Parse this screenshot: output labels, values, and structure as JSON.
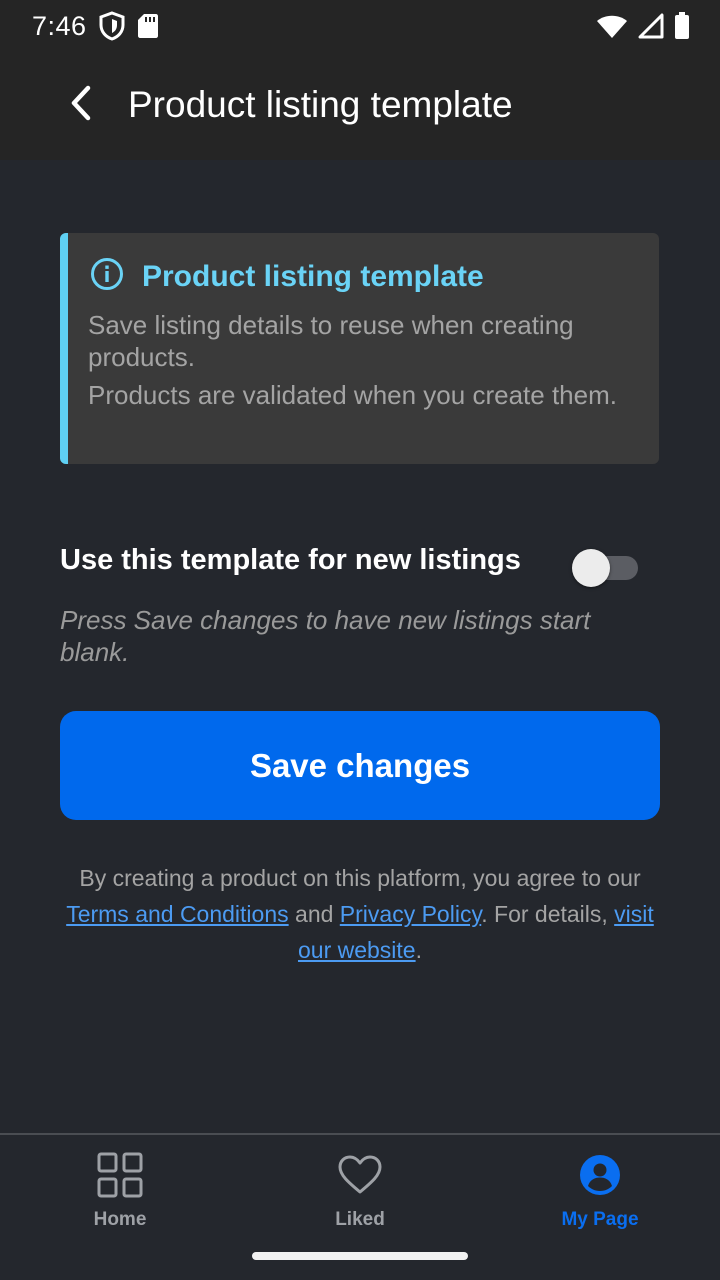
{
  "status_bar": {
    "time": "7:46",
    "icons": [
      "shield-icon",
      "sd-card-icon",
      "wifi-icon",
      "signal-icon",
      "battery-icon"
    ]
  },
  "app_bar": {
    "back_icon": "chevron-left-icon",
    "title": "Product listing template"
  },
  "info_card": {
    "icon": "info-icon",
    "title": "Product listing template",
    "line1": "Save listing details to reuse when creating products.",
    "line2": "Products are validated when you create them.",
    "accent_color": "#5fd0f3"
  },
  "template_toggle": {
    "label": "Use this template for new listings",
    "enabled": false,
    "hint": "Press Save changes to have new listings start blank."
  },
  "save_button": {
    "label": "Save changes",
    "color": "#0069ed"
  },
  "legal": {
    "prefix": "By creating a product on this platform, you agree to our ",
    "terms_link": "Terms and Conditions",
    "and": " and ",
    "privacy_link": "Privacy Policy",
    "middle": ". For details, ",
    "website_link": "visit our website",
    "suffix": "."
  },
  "bottom_nav": {
    "items": [
      {
        "label": "Home",
        "icon": "grid-icon",
        "active": false
      },
      {
        "label": "Liked",
        "icon": "heart-icon",
        "active": false
      },
      {
        "label": "My Page",
        "icon": "account-circle-icon",
        "active": true
      }
    ],
    "active_color": "#0a6ef0"
  }
}
